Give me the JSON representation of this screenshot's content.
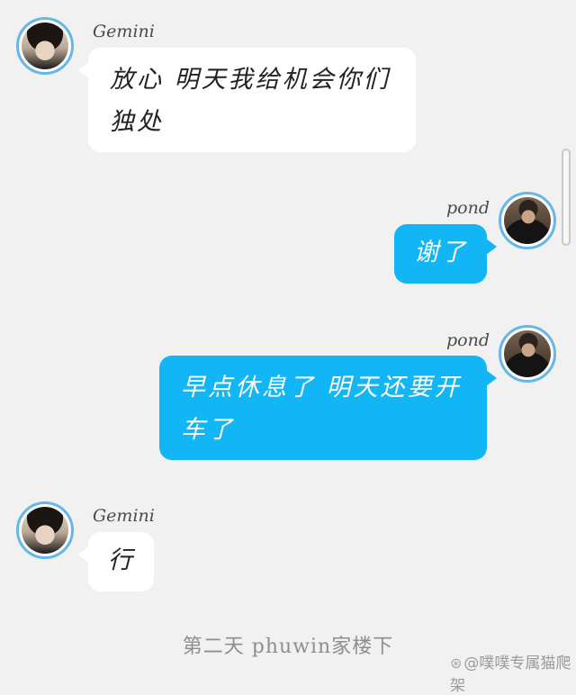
{
  "messages": [
    {
      "sender": "Gemini",
      "side": "left",
      "text_lines": [
        "放心 明天我给机会你们",
        "独处"
      ]
    },
    {
      "sender": "pond",
      "side": "right",
      "text_lines": [
        "谢了"
      ]
    },
    {
      "sender": "pond",
      "side": "right",
      "text_lines": [
        "早点休息了 明天还要开",
        "车了"
      ]
    },
    {
      "sender": "Gemini",
      "side": "left",
      "text_lines": [
        "行"
      ]
    }
  ],
  "footer": {
    "caption": "第二天 phuwin家楼下"
  },
  "watermark": {
    "text": "@噗噗专属猫爬架",
    "icon": "weibo-icon"
  },
  "colors": {
    "background": "#f1f1f1",
    "own_bubble": "#12b6f5",
    "other_bubble": "#ffffff",
    "avatar_ring": "#64b7e6"
  }
}
